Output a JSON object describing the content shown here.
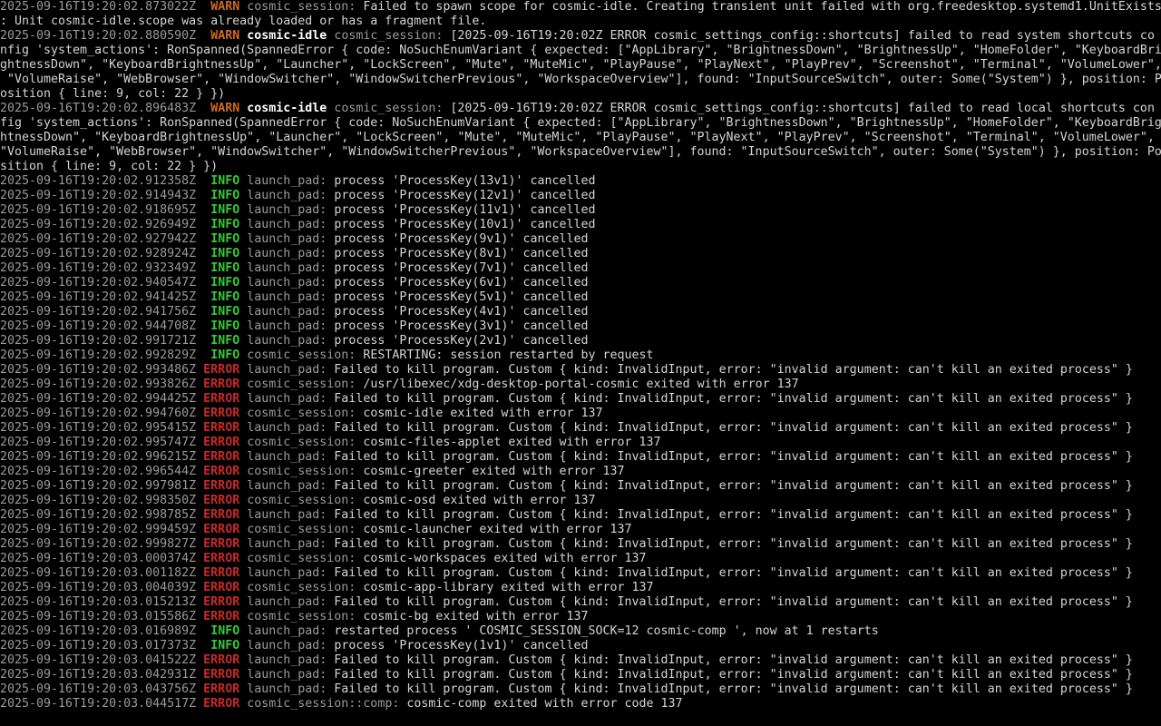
{
  "colors": {
    "background": "#000000",
    "timestamp": "#9a9a9a",
    "warn": "#d06a1e",
    "info": "#37c837",
    "error": "#c82828",
    "target": "#9a9a9a",
    "message": "#d4d4d4"
  },
  "lines": [
    {
      "ts": "2025-09-16T19:20:02.873022Z",
      "level": "WARN",
      "tgt": "cosmic_session:",
      "msg": "Failed to spawn scope for cosmic-idle. Creating transient unit failed with org.freedesktop.systemd1.UnitExists"
    },
    {
      "cont": ": Unit cosmic-idle.scope was already loaded or has a fragment file."
    },
    {
      "ts": "2025-09-16T19:20:02.880590Z",
      "level": "WARN",
      "hi": "cosmic-idle",
      "tgt": "cosmic_session:",
      "msg": "[2025-09-16T19:20:02Z ERROR cosmic_settings_config::shortcuts] failed to read system shortcuts co"
    },
    {
      "cont": "nfig 'system_actions': RonSpanned(SpannedError { code: NoSuchEnumVariant { expected: [\"AppLibrary\", \"BrightnessDown\", \"BrightnessUp\", \"HomeFolder\", \"KeyboardBri"
    },
    {
      "cont": "ghtnessDown\", \"KeyboardBrightnessUp\", \"Launcher\", \"LockScreen\", \"Mute\", \"MuteMic\", \"PlayPause\", \"PlayNext\", \"PlayPrev\", \"Screenshot\", \"Terminal\", \"VolumeLower\","
    },
    {
      "cont": " \"VolumeRaise\", \"WebBrowser\", \"WindowSwitcher\", \"WindowSwitcherPrevious\", \"WorkspaceOverview\"], found: \"InputSourceSwitch\", outer: Some(\"System\") }, position: P"
    },
    {
      "cont": "osition { line: 9, col: 22 } })"
    },
    {
      "ts": "2025-09-16T19:20:02.896483Z",
      "level": "WARN",
      "hi": "cosmic-idle",
      "tgt": "cosmic_session:",
      "msg": "[2025-09-16T19:20:02Z ERROR cosmic_settings_config::shortcuts] failed to read local shortcuts con"
    },
    {
      "cont": "fig 'system_actions': RonSpanned(SpannedError { code: NoSuchEnumVariant { expected: [\"AppLibrary\", \"BrightnessDown\", \"BrightnessUp\", \"HomeFolder\", \"KeyboardBrig"
    },
    {
      "cont": "htnessDown\", \"KeyboardBrightnessUp\", \"Launcher\", \"LockScreen\", \"Mute\", \"MuteMic\", \"PlayPause\", \"PlayNext\", \"PlayPrev\", \"Screenshot\", \"Terminal\", \"VolumeLower\","
    },
    {
      "cont": "\"VolumeRaise\", \"WebBrowser\", \"WindowSwitcher\", \"WindowSwitcherPrevious\", \"WorkspaceOverview\"], found: \"InputSourceSwitch\", outer: Some(\"System\") }, position: Po"
    },
    {
      "cont": "sition { line: 9, col: 22 } })"
    },
    {
      "ts": "2025-09-16T19:20:02.912358Z",
      "level": "INFO",
      "tgt": "launch_pad:",
      "msg": "process 'ProcessKey(13v1)' cancelled"
    },
    {
      "ts": "2025-09-16T19:20:02.914943Z",
      "level": "INFO",
      "tgt": "launch_pad:",
      "msg": "process 'ProcessKey(12v1)' cancelled"
    },
    {
      "ts": "2025-09-16T19:20:02.918695Z",
      "level": "INFO",
      "tgt": "launch_pad:",
      "msg": "process 'ProcessKey(11v1)' cancelled"
    },
    {
      "ts": "2025-09-16T19:20:02.926949Z",
      "level": "INFO",
      "tgt": "launch_pad:",
      "msg": "process 'ProcessKey(10v1)' cancelled"
    },
    {
      "ts": "2025-09-16T19:20:02.927942Z",
      "level": "INFO",
      "tgt": "launch_pad:",
      "msg": "process 'ProcessKey(9v1)' cancelled"
    },
    {
      "ts": "2025-09-16T19:20:02.928924Z",
      "level": "INFO",
      "tgt": "launch_pad:",
      "msg": "process 'ProcessKey(8v1)' cancelled"
    },
    {
      "ts": "2025-09-16T19:20:02.932349Z",
      "level": "INFO",
      "tgt": "launch_pad:",
      "msg": "process 'ProcessKey(7v1)' cancelled"
    },
    {
      "ts": "2025-09-16T19:20:02.940547Z",
      "level": "INFO",
      "tgt": "launch_pad:",
      "msg": "process 'ProcessKey(6v1)' cancelled"
    },
    {
      "ts": "2025-09-16T19:20:02.941425Z",
      "level": "INFO",
      "tgt": "launch_pad:",
      "msg": "process 'ProcessKey(5v1)' cancelled"
    },
    {
      "ts": "2025-09-16T19:20:02.941756Z",
      "level": "INFO",
      "tgt": "launch_pad:",
      "msg": "process 'ProcessKey(4v1)' cancelled"
    },
    {
      "ts": "2025-09-16T19:20:02.944708Z",
      "level": "INFO",
      "tgt": "launch_pad:",
      "msg": "process 'ProcessKey(3v1)' cancelled"
    },
    {
      "ts": "2025-09-16T19:20:02.991721Z",
      "level": "INFO",
      "tgt": "launch_pad:",
      "msg": "process 'ProcessKey(2v1)' cancelled"
    },
    {
      "ts": "2025-09-16T19:20:02.992829Z",
      "level": "INFO",
      "tgt": "cosmic_session:",
      "msg": "RESTARTING: session restarted by request"
    },
    {
      "ts": "2025-09-16T19:20:02.993486Z",
      "level": "ERROR",
      "tgt": "launch_pad:",
      "msg": "Failed to kill program. Custom { kind: InvalidInput, error: \"invalid argument: can't kill an exited process\" }"
    },
    {
      "ts": "2025-09-16T19:20:02.993826Z",
      "level": "ERROR",
      "tgt": "cosmic_session:",
      "msg": "/usr/libexec/xdg-desktop-portal-cosmic exited with error 137"
    },
    {
      "ts": "2025-09-16T19:20:02.994425Z",
      "level": "ERROR",
      "tgt": "launch_pad:",
      "msg": "Failed to kill program. Custom { kind: InvalidInput, error: \"invalid argument: can't kill an exited process\" }"
    },
    {
      "ts": "2025-09-16T19:20:02.994760Z",
      "level": "ERROR",
      "tgt": "cosmic_session:",
      "msg": "cosmic-idle exited with error 137"
    },
    {
      "ts": "2025-09-16T19:20:02.995415Z",
      "level": "ERROR",
      "tgt": "launch_pad:",
      "msg": "Failed to kill program. Custom { kind: InvalidInput, error: \"invalid argument: can't kill an exited process\" }"
    },
    {
      "ts": "2025-09-16T19:20:02.995747Z",
      "level": "ERROR",
      "tgt": "cosmic_session:",
      "msg": "cosmic-files-applet exited with error 137"
    },
    {
      "ts": "2025-09-16T19:20:02.996215Z",
      "level": "ERROR",
      "tgt": "launch_pad:",
      "msg": "Failed to kill program. Custom { kind: InvalidInput, error: \"invalid argument: can't kill an exited process\" }"
    },
    {
      "ts": "2025-09-16T19:20:02.996544Z",
      "level": "ERROR",
      "tgt": "cosmic_session:",
      "msg": "cosmic-greeter exited with error 137"
    },
    {
      "ts": "2025-09-16T19:20:02.997981Z",
      "level": "ERROR",
      "tgt": "launch_pad:",
      "msg": "Failed to kill program. Custom { kind: InvalidInput, error: \"invalid argument: can't kill an exited process\" }"
    },
    {
      "ts": "2025-09-16T19:20:02.998350Z",
      "level": "ERROR",
      "tgt": "cosmic_session:",
      "msg": "cosmic-osd exited with error 137"
    },
    {
      "ts": "2025-09-16T19:20:02.998785Z",
      "level": "ERROR",
      "tgt": "launch_pad:",
      "msg": "Failed to kill program. Custom { kind: InvalidInput, error: \"invalid argument: can't kill an exited process\" }"
    },
    {
      "ts": "2025-09-16T19:20:02.999459Z",
      "level": "ERROR",
      "tgt": "cosmic_session:",
      "msg": "cosmic-launcher exited with error 137"
    },
    {
      "ts": "2025-09-16T19:20:02.999827Z",
      "level": "ERROR",
      "tgt": "launch_pad:",
      "msg": "Failed to kill program. Custom { kind: InvalidInput, error: \"invalid argument: can't kill an exited process\" }"
    },
    {
      "ts": "2025-09-16T19:20:03.000374Z",
      "level": "ERROR",
      "tgt": "cosmic_session:",
      "msg": "cosmic-workspaces exited with error 137"
    },
    {
      "ts": "2025-09-16T19:20:03.001182Z",
      "level": "ERROR",
      "tgt": "launch_pad:",
      "msg": "Failed to kill program. Custom { kind: InvalidInput, error: \"invalid argument: can't kill an exited process\" }"
    },
    {
      "ts": "2025-09-16T19:20:03.004039Z",
      "level": "ERROR",
      "tgt": "cosmic_session:",
      "msg": "cosmic-app-library exited with error 137"
    },
    {
      "ts": "2025-09-16T19:20:03.015213Z",
      "level": "ERROR",
      "tgt": "launch_pad:",
      "msg": "Failed to kill program. Custom { kind: InvalidInput, error: \"invalid argument: can't kill an exited process\" }"
    },
    {
      "ts": "2025-09-16T19:20:03.015586Z",
      "level": "ERROR",
      "tgt": "cosmic_session:",
      "msg": "cosmic-bg exited with error 137"
    },
    {
      "ts": "2025-09-16T19:20:03.016989Z",
      "level": "INFO",
      "tgt": "launch_pad:",
      "msg": "restarted process ' COSMIC_SESSION_SOCK=12 cosmic-comp ', now at 1 restarts"
    },
    {
      "ts": "2025-09-16T19:20:03.017373Z",
      "level": "INFO",
      "tgt": "launch_pad:",
      "msg": "process 'ProcessKey(1v1)' cancelled"
    },
    {
      "ts": "2025-09-16T19:20:03.041522Z",
      "level": "ERROR",
      "tgt": "launch_pad:",
      "msg": "Failed to kill program. Custom { kind: InvalidInput, error: \"invalid argument: can't kill an exited process\" }"
    },
    {
      "ts": "2025-09-16T19:20:03.042931Z",
      "level": "ERROR",
      "tgt": "launch_pad:",
      "msg": "Failed to kill program. Custom { kind: InvalidInput, error: \"invalid argument: can't kill an exited process\" }"
    },
    {
      "ts": "2025-09-16T19:20:03.043756Z",
      "level": "ERROR",
      "tgt": "launch_pad:",
      "msg": "Failed to kill program. Custom { kind: InvalidInput, error: \"invalid argument: can't kill an exited process\" }"
    },
    {
      "ts": "2025-09-16T19:20:03.044517Z",
      "level": "ERROR",
      "tgt": "cosmic_session::comp:",
      "msg": "cosmic-comp exited with error code 137"
    }
  ]
}
